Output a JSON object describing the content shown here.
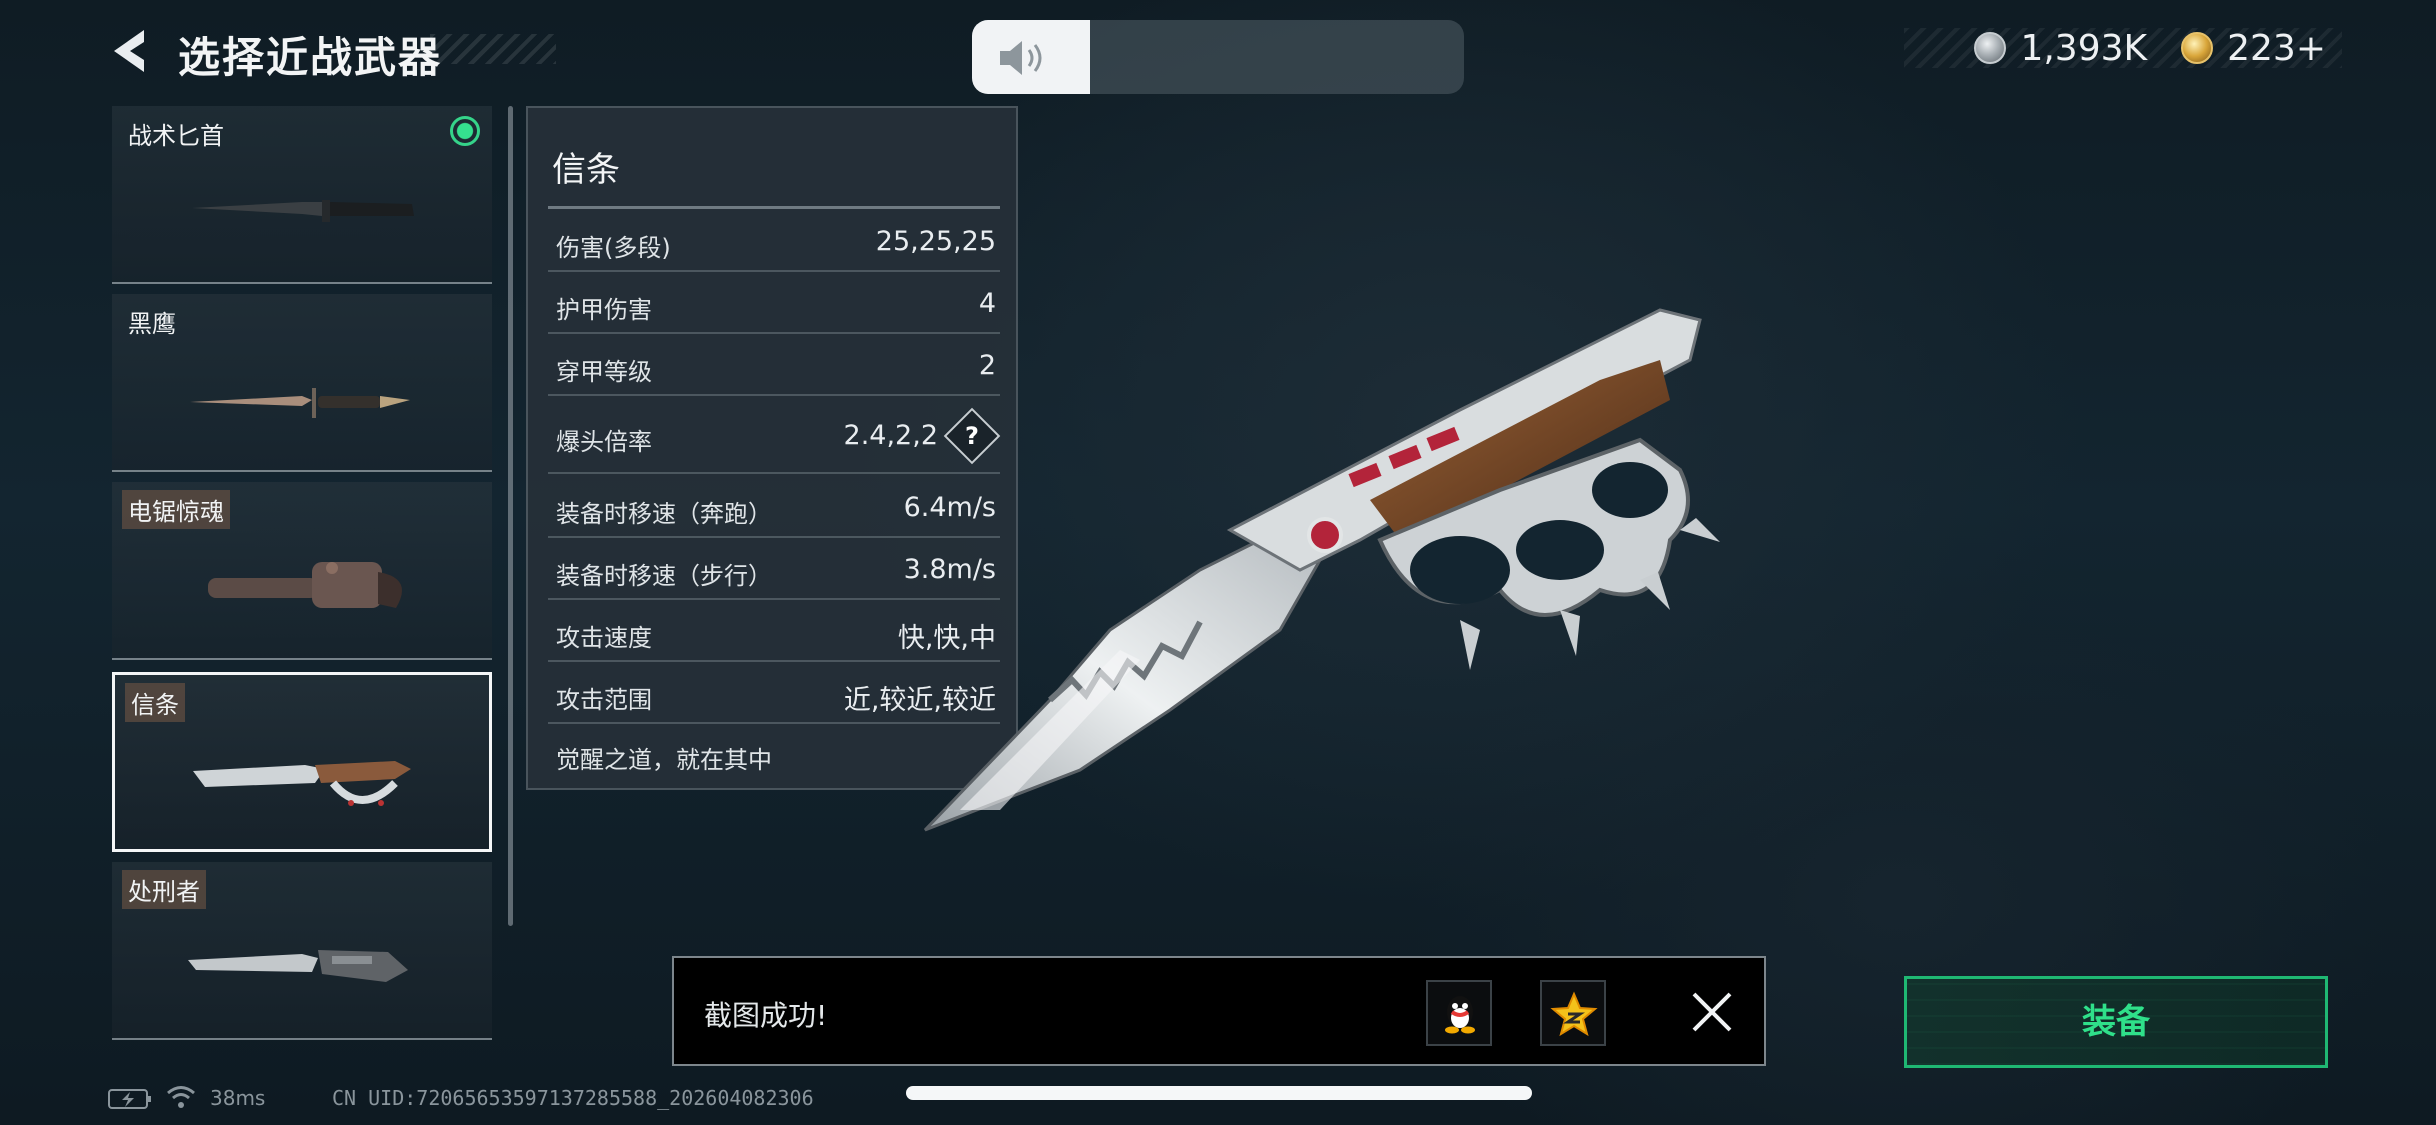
{
  "header": {
    "title": "选择近战武器",
    "back_icon": "back-arrow-icon"
  },
  "volume": {
    "icon": "speaker-icon",
    "level": 0.24
  },
  "currency": [
    {
      "icon": "silver-coin-icon",
      "value": "1,393K"
    },
    {
      "icon": "gold-coin-icon",
      "value": "223+"
    }
  ],
  "weapons": [
    {
      "name": "战术匕首",
      "equipped": true,
      "selected": false
    },
    {
      "name": "黑鹰",
      "equipped": false,
      "selected": false
    },
    {
      "name": "电锯惊魂",
      "equipped": false,
      "selected": false
    },
    {
      "name": "信条",
      "equipped": false,
      "selected": true
    },
    {
      "name": "处刑者",
      "equipped": false,
      "selected": false
    }
  ],
  "stats": {
    "title": "信条",
    "rows": [
      {
        "label": "伤害(多段)",
        "value": "25,25,25"
      },
      {
        "label": "护甲伤害",
        "value": "4"
      },
      {
        "label": "穿甲等级",
        "value": "2"
      },
      {
        "label": "爆头倍率",
        "value": "2.4,2,2",
        "help": "?"
      },
      {
        "label": "装备时移速（奔跑）",
        "value": "6.4m/s"
      },
      {
        "label": "装备时移速（步行）",
        "value": "3.8m/s"
      },
      {
        "label": "攻击速度",
        "value": "快,快,中"
      },
      {
        "label": "攻击范围",
        "value": "近,较近,较近"
      }
    ],
    "description": "觉醒之道，就在其中"
  },
  "toast": {
    "message": "截图成功!",
    "share_icons": [
      "qq-icon",
      "qzone-icon"
    ],
    "close_icon": "close-icon"
  },
  "equip": {
    "label": "装备"
  },
  "footer": {
    "ping": "38ms",
    "uid": "CN UID:720656535971372855​88_202604082306"
  },
  "colors": {
    "accent_green": "#2fe08a",
    "equipped_dot": "#35d48a"
  }
}
